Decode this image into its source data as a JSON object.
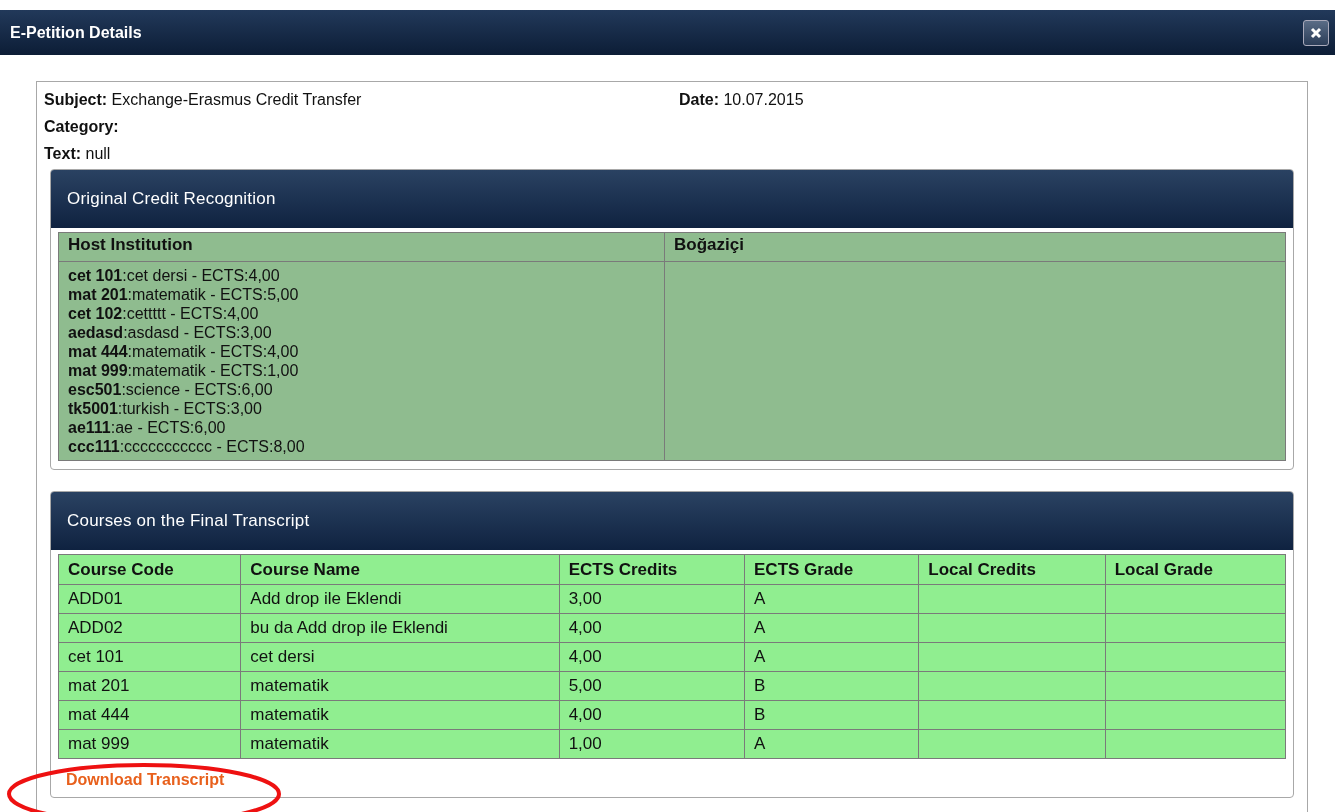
{
  "window": {
    "title": "E-Petition Details"
  },
  "details": [
    {
      "label": "Subject:",
      "value": "Exchange-Erasmus Credit Transfer"
    },
    {
      "label": "Date:",
      "value": "10.07.2015"
    },
    {
      "label": "Category:"
    },
    {
      "label": "Text:",
      "value": "null"
    }
  ],
  "original_credit_recognition": {
    "title": "Original Credit Recognition",
    "columns": [
      "Host Institution",
      "Boğaziçi"
    ],
    "host_courses": [
      {
        "code": "cet 101",
        "text": ":cet dersi - ECTS:4,00"
      },
      {
        "code": "mat 201",
        "text": ":matematik - ECTS:5,00"
      },
      {
        "code": "cet 102",
        "text": ":cettttt - ECTS:4,00"
      },
      {
        "code": "aedasd",
        "text": ":asdasd - ECTS:3,00"
      },
      {
        "code": "mat 444",
        "text": ":matematik - ECTS:4,00"
      },
      {
        "code": "mat 999",
        "text": ":matematik - ECTS:1,00"
      },
      {
        "code": "esc501",
        "text": ":science - ECTS:6,00"
      },
      {
        "code": "tk5001",
        "text": ":turkish - ECTS:3,00"
      },
      {
        "code": "ae111",
        "text": ":ae - ECTS:6,00"
      },
      {
        "code": "ccc111",
        "text": ":ccccccccccc - ECTS:8,00"
      }
    ]
  },
  "final_transcript": {
    "title": "Courses on the Final Transcript",
    "columns": [
      "Course Code",
      "Course Name",
      "ECTS Credits",
      "ECTS Grade",
      "Local Credits",
      "Local Grade"
    ],
    "rows": [
      [
        "ADD01",
        "Add drop ile Eklendi",
        "3,00",
        "A",
        "",
        ""
      ],
      [
        "ADD02",
        "bu da Add drop ile Eklendi",
        "4,00",
        "A",
        "",
        ""
      ],
      [
        "cet 101",
        "cet dersi",
        "4,00",
        "A",
        "",
        ""
      ],
      [
        "mat 201",
        "matematik",
        "5,00",
        "B",
        "",
        ""
      ],
      [
        "mat 444",
        "matematik",
        "4,00",
        "B",
        "",
        ""
      ],
      [
        "mat 999",
        "matematik",
        "1,00",
        "A",
        "",
        ""
      ]
    ]
  },
  "download_link": "Download Transcript"
}
